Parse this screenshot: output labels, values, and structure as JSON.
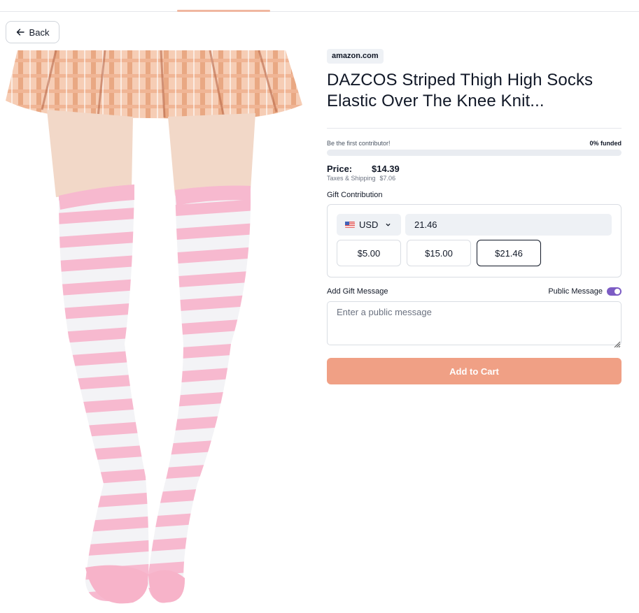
{
  "nav": {
    "back_label": "Back"
  },
  "product": {
    "source": "amazon.com",
    "title": "DAZCOS Striped Thigh High Socks Elastic Over The Knee Knit..."
  },
  "funding": {
    "contributor_text": "Be the first contributor!",
    "funded_text": "0% funded",
    "progress_fraction": 0
  },
  "pricing": {
    "price_label": "Price:",
    "price_value": "$14.39",
    "tax_label": "Taxes & Shipping",
    "tax_value": "$7.06"
  },
  "gift": {
    "section_label": "Gift Contribution",
    "currency": "USD",
    "amount": "21.46",
    "presets": [
      "$5.00",
      "$15.00",
      "$21.46"
    ],
    "selected_preset": "$21.46"
  },
  "message": {
    "label": "Add Gift Message",
    "public_label": "Public Message",
    "public_enabled": true,
    "placeholder": "Enter a public message"
  },
  "cart": {
    "button_label": "Add to Cart"
  },
  "colors": {
    "accent": "#f0a085",
    "toggle": "#7c5cc4",
    "sock_pink": "#f7b9cf",
    "sock_white": "#f3f3f6",
    "skirt_peach": "#f0b89a"
  },
  "icons": {
    "back": "arrow-left-icon",
    "currency_dropdown": "chevron-down-icon",
    "flag": "us-flag-icon"
  }
}
